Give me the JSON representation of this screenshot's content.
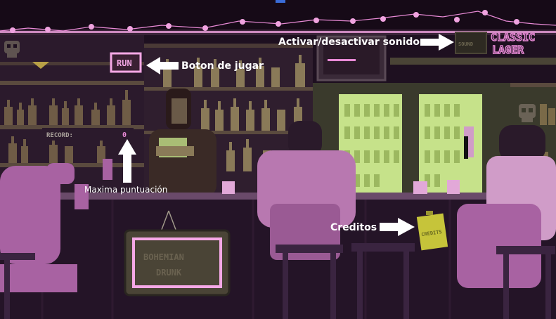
{
  "game": {
    "run_button_label": "RUN",
    "record_label": "RECORD:",
    "record_value": "0",
    "sign_line1": "BOHEMIAN",
    "sign_line2": "DRUNK",
    "neon_line1": "CLASSIC",
    "neon_line2": "LAGER",
    "sound_panel": "SOUND",
    "credits_note": "CREDITS"
  },
  "annotations": {
    "play_button": "Boton de jugar",
    "sound_toggle": "Activar/desactivar sonido",
    "high_score": "Maxima puntuación",
    "credits": "Creditos"
  },
  "colors": {
    "accent_pink": "#e88ad6",
    "bottle_green": "#c6e28a",
    "bar_dark": "#241427",
    "annotation": "#ffffff"
  },
  "icons": [
    "skull-icon",
    "arrow-right-icon",
    "arrow-left-icon",
    "arrow-up-icon"
  ]
}
